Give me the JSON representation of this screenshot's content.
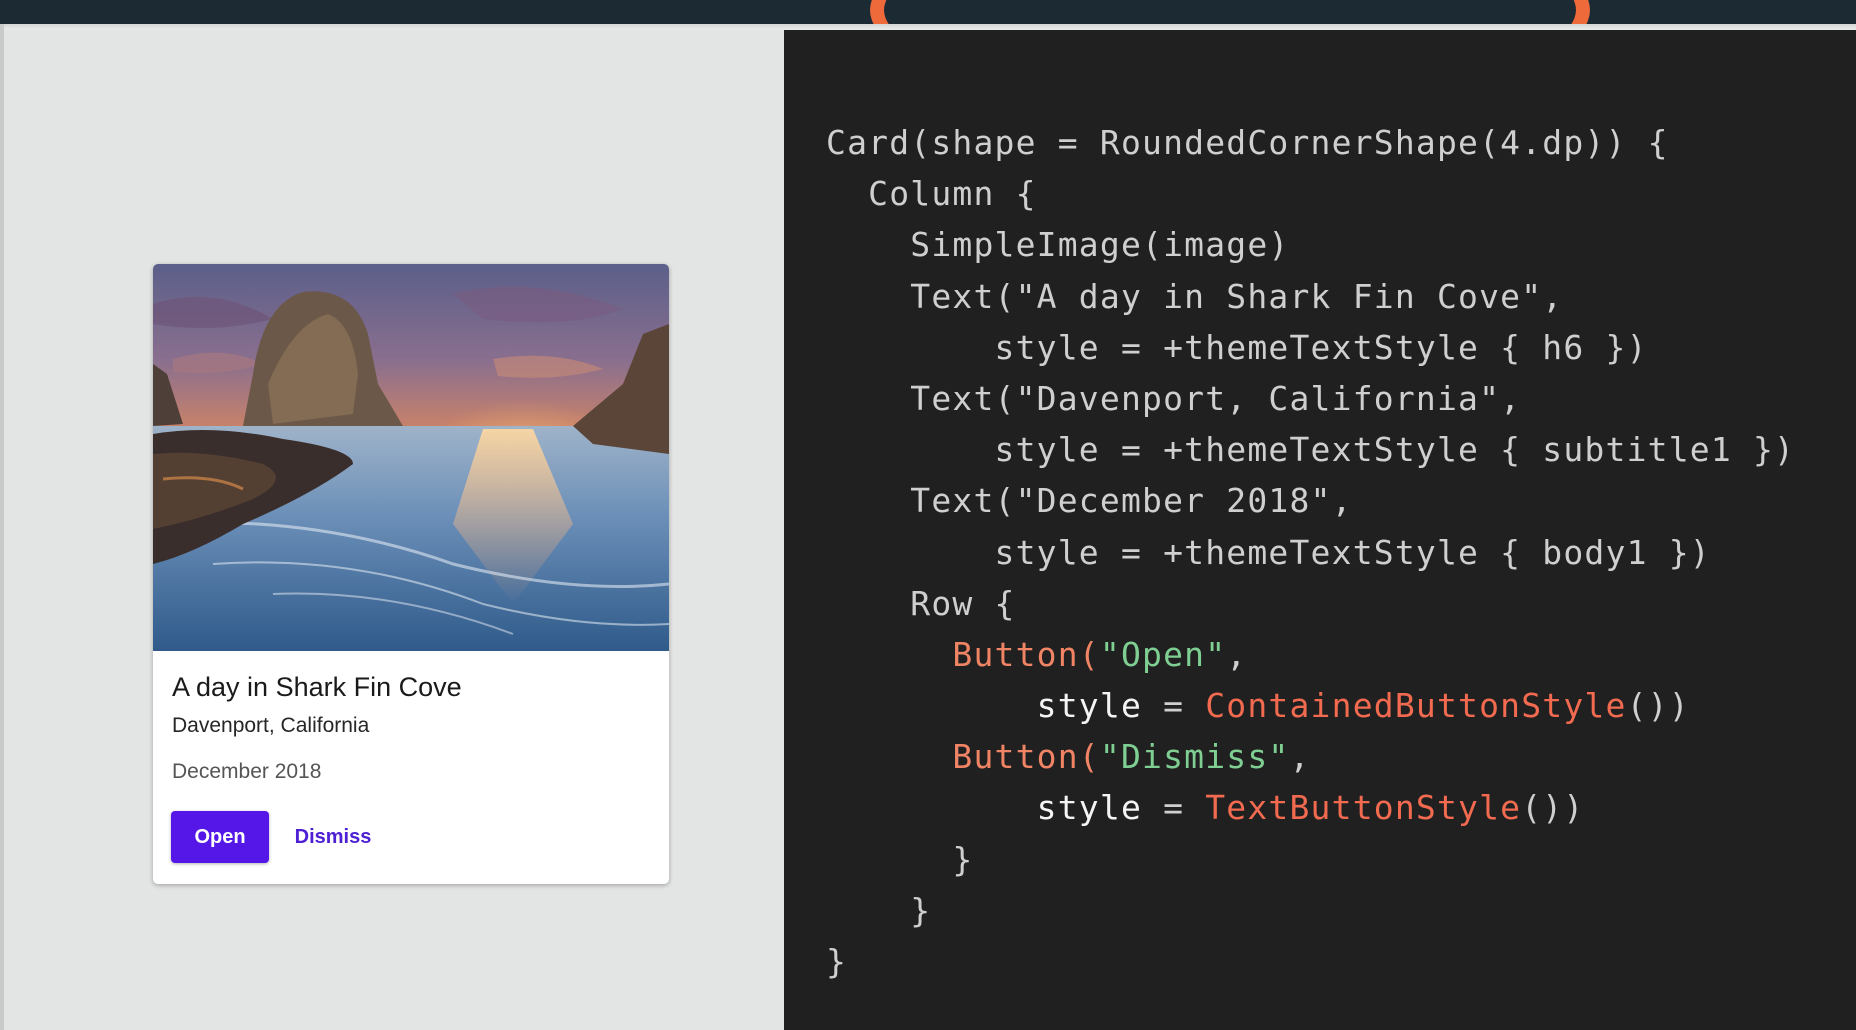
{
  "colors": {
    "accent": "#5417e8",
    "code_background": "#202020",
    "slide_background": "#e3e4e4",
    "top_bar": "#1c2a33",
    "top_bar_arc": "#ee6a3b"
  },
  "card": {
    "image_icon": "coastal-sunset-photo",
    "title": "A day in Shark Fin Cove",
    "subtitle": "Davenport, California",
    "date": "December 2018",
    "buttons": {
      "open_label": "Open",
      "dismiss_label": "Dismiss"
    }
  },
  "code": {
    "lines": [
      [
        {
          "t": "Card(shape = RoundedCornerShape(4.dp)) {",
          "c": "plain"
        }
      ],
      [
        {
          "t": "  Column {",
          "c": "plain"
        }
      ],
      [
        {
          "t": "    SimpleImage(image)",
          "c": "plain"
        }
      ],
      [
        {
          "t": "    Text(\"A day in Shark Fin Cove\",",
          "c": "plain"
        }
      ],
      [
        {
          "t": "        style = +themeTextStyle { h6 })",
          "c": "plain"
        }
      ],
      [
        {
          "t": "    Text(\"Davenport, California\",",
          "c": "plain"
        }
      ],
      [
        {
          "t": "        style = +themeTextStyle { subtitle1 })",
          "c": "plain"
        }
      ],
      [
        {
          "t": "    Text(\"December 2018\",",
          "c": "plain"
        }
      ],
      [
        {
          "t": "        style = +themeTextStyle { body1 })",
          "c": "plain"
        }
      ],
      [
        {
          "t": "    Row {",
          "c": "plain"
        }
      ],
      [
        {
          "t": "      ",
          "c": "plain"
        },
        {
          "t": "Button(",
          "c": "orange"
        },
        {
          "t": "\"Open\"",
          "c": "green"
        },
        {
          "t": ",",
          "c": "plain"
        }
      ],
      [
        {
          "t": "          style",
          "c": "white"
        },
        {
          "t": " = ",
          "c": "plain"
        },
        {
          "t": "ContainedButtonStyle",
          "c": "red"
        },
        {
          "t": "())",
          "c": "plain"
        }
      ],
      [
        {
          "t": "      ",
          "c": "plain"
        },
        {
          "t": "Button(",
          "c": "orange"
        },
        {
          "t": "\"Dismiss\"",
          "c": "green"
        },
        {
          "t": ",",
          "c": "plain"
        }
      ],
      [
        {
          "t": "          style",
          "c": "white"
        },
        {
          "t": " = ",
          "c": "plain"
        },
        {
          "t": "TextButtonStyle",
          "c": "red"
        },
        {
          "t": "())",
          "c": "plain"
        }
      ],
      [
        {
          "t": "      }",
          "c": "plain"
        }
      ],
      [
        {
          "t": "    }",
          "c": "plain"
        }
      ],
      [
        {
          "t": "}",
          "c": "plain"
        }
      ]
    ]
  }
}
